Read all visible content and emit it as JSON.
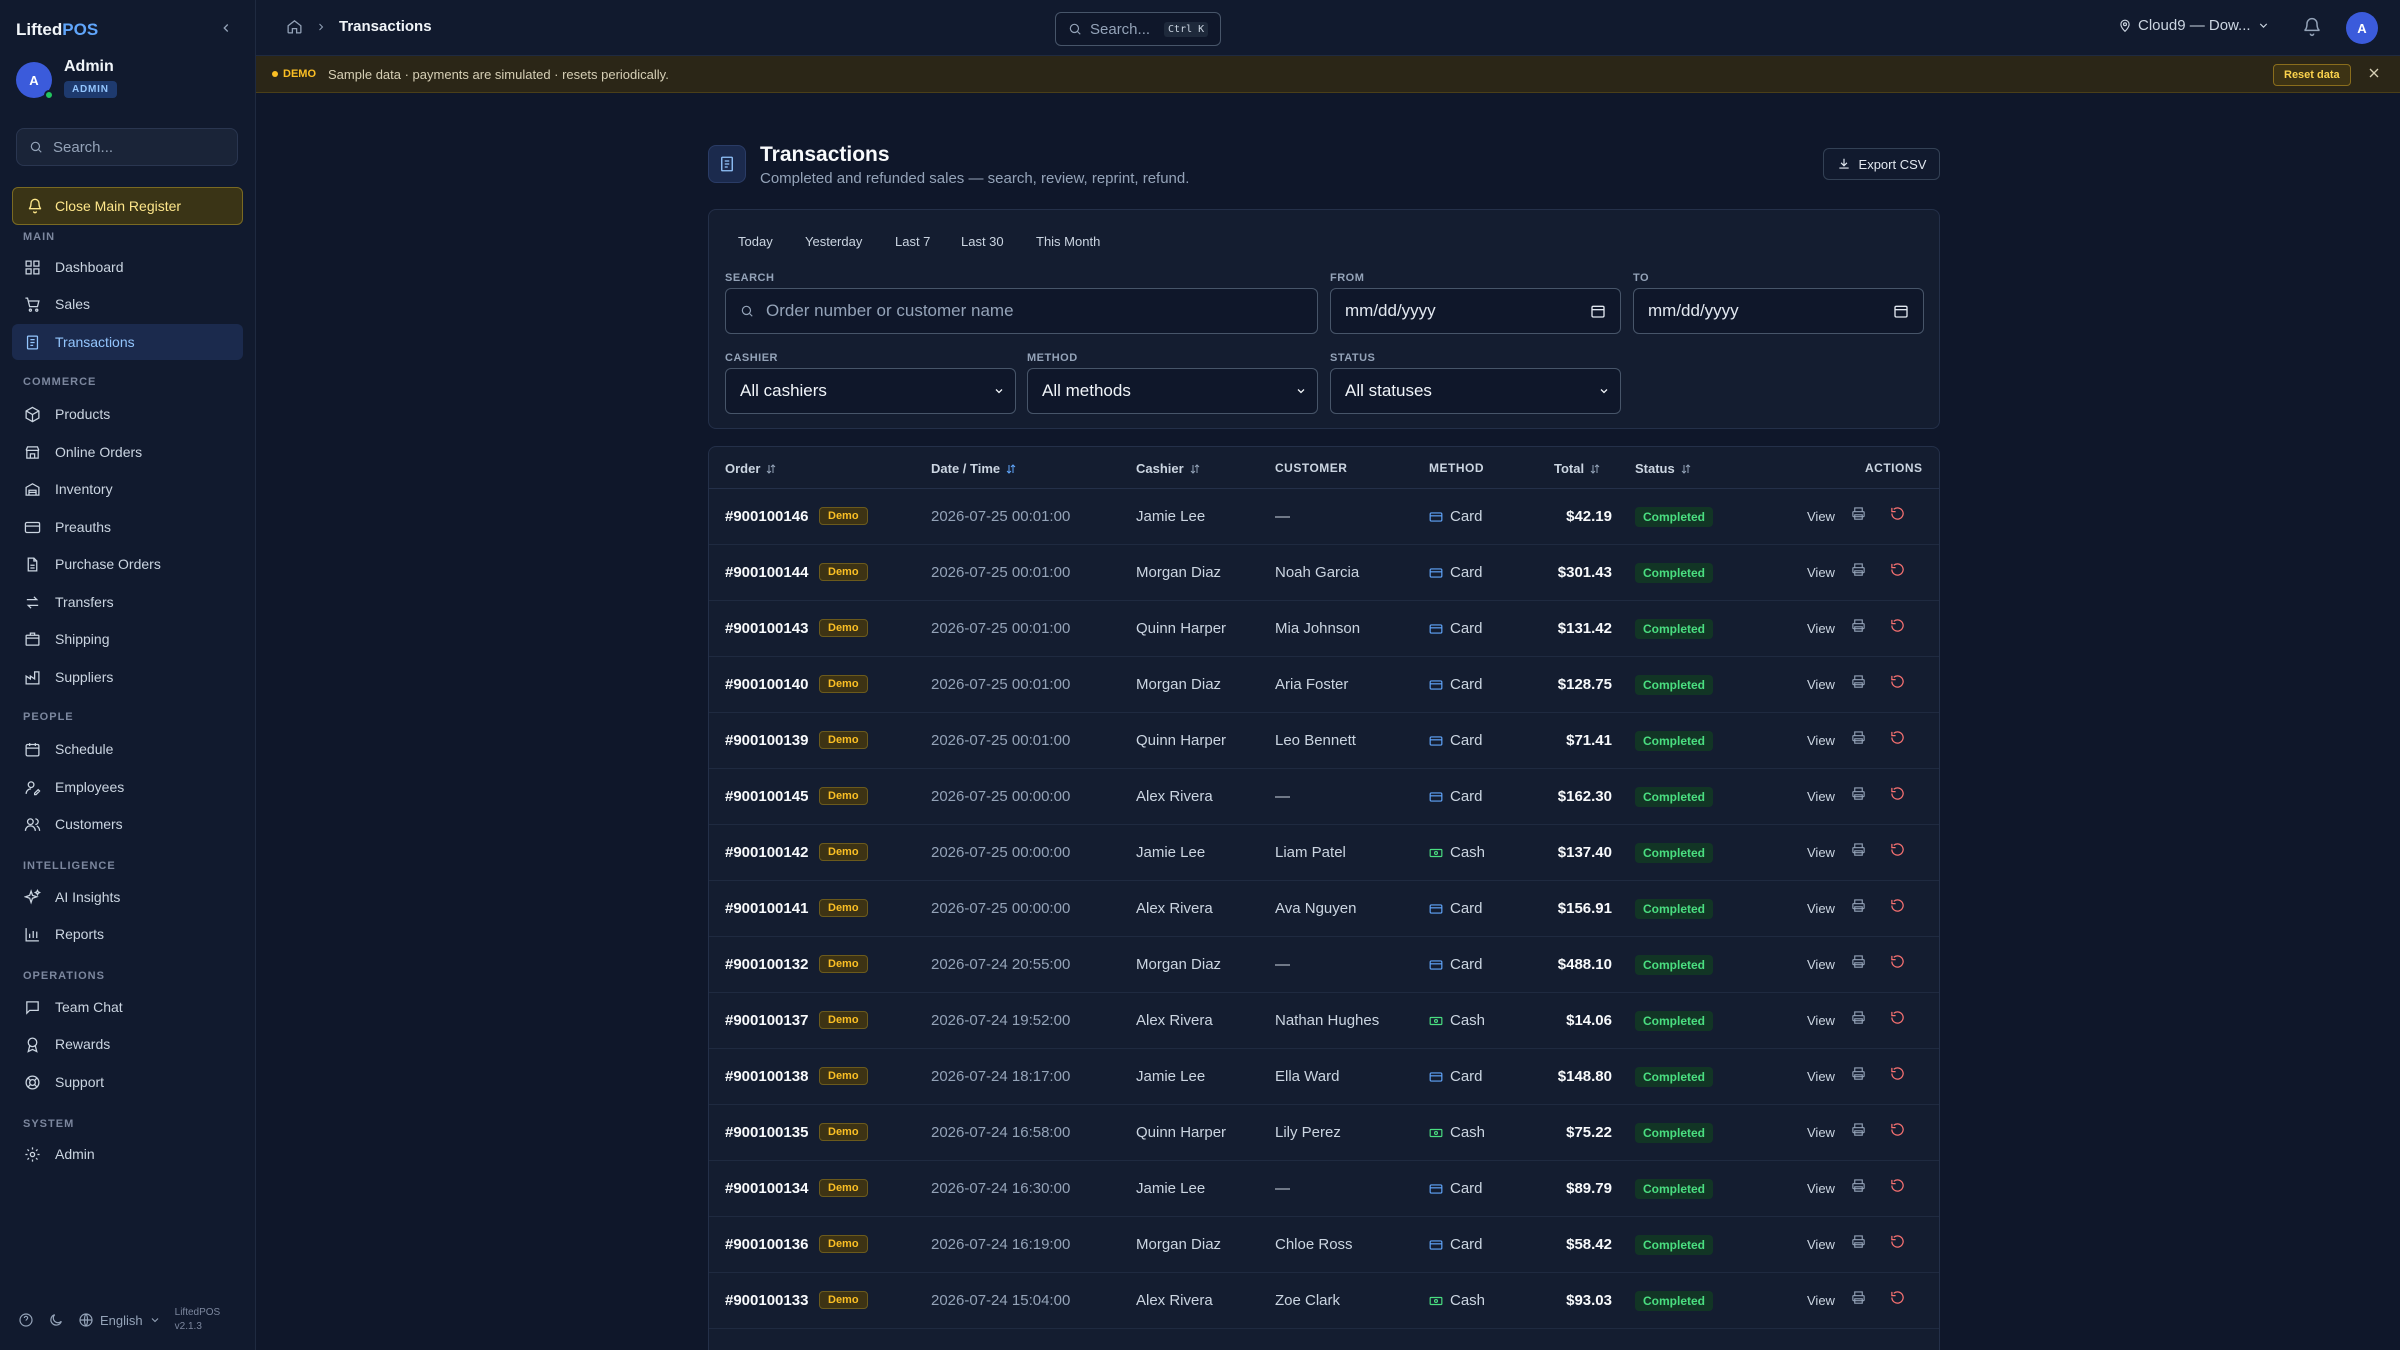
{
  "app": {
    "brand_part1": "Lifted",
    "brand_part2": "POS"
  },
  "user": {
    "initial": "A",
    "name": "Admin",
    "role": "ADMIN"
  },
  "sidebar": {
    "search_placeholder": "Search...",
    "close_register": "Close Main Register",
    "sections": {
      "main": "MAIN",
      "commerce": "COMMERCE",
      "people": "PEOPLE",
      "intelligence": "INTELLIGENCE",
      "operations": "OPERATIONS",
      "system": "SYSTEM"
    },
    "items": {
      "dashboard": "Dashboard",
      "sales": "Sales",
      "transactions": "Transactions",
      "products": "Products",
      "online_orders": "Online Orders",
      "inventory": "Inventory",
      "preauths": "Preauths",
      "purchase_orders": "Purchase Orders",
      "transfers": "Transfers",
      "shipping": "Shipping",
      "suppliers": "Suppliers",
      "schedule": "Schedule",
      "employees": "Employees",
      "customers": "Customers",
      "ai_insights": "AI Insights",
      "reports": "Reports",
      "team_chat": "Team Chat",
      "rewards": "Rewards",
      "support": "Support",
      "admin": "Admin"
    },
    "footer": {
      "language": "English",
      "app_name": "LiftedPOS",
      "version": "v2.1.3"
    }
  },
  "topbar": {
    "breadcrumb_current": "Transactions",
    "search_label": "Search...",
    "search_shortcut": "Ctrl K",
    "location": "Cloud9 — Dow...",
    "avatar_initial": "A"
  },
  "banner": {
    "tag": "DEMO",
    "message": "Sample data · payments are simulated · resets periodically.",
    "reset_label": "Reset data"
  },
  "page": {
    "title": "Transactions",
    "subtitle": "Completed and refunded sales — search, review, reprint, refund.",
    "export_label": "Export CSV"
  },
  "filters": {
    "quick_ranges": [
      "Today",
      "Yesterday",
      "Last 7",
      "Last 30",
      "This Month"
    ],
    "search_label": "SEARCH",
    "search_placeholder": "Order number or customer name",
    "from_label": "FROM",
    "from_value": "mm/dd/yyyy",
    "to_label": "TO",
    "to_value": "mm/dd/yyyy",
    "cashier_label": "CASHIER",
    "cashier_value": "All cashiers",
    "method_label": "METHOD",
    "method_value": "All methods",
    "status_label": "STATUS",
    "status_value": "All statuses"
  },
  "table": {
    "headers": {
      "order": "Order",
      "date": "Date / Time",
      "cashier": "Cashier",
      "customer": "CUSTOMER",
      "method": "METHOD",
      "total": "Total",
      "status": "Status",
      "actions": "ACTIONS"
    },
    "demo_badge": "Demo",
    "view_label": "View",
    "rows": [
      {
        "order": "#900100146",
        "date": "2026-07-25 00:01:00",
        "cashier": "Jamie Lee",
        "customer": "—",
        "method": "Card",
        "total": "$42.19",
        "status": "Completed"
      },
      {
        "order": "#900100144",
        "date": "2026-07-25 00:01:00",
        "cashier": "Morgan Diaz",
        "customer": "Noah Garcia",
        "method": "Card",
        "total": "$301.43",
        "status": "Completed"
      },
      {
        "order": "#900100143",
        "date": "2026-07-25 00:01:00",
        "cashier": "Quinn Harper",
        "customer": "Mia Johnson",
        "method": "Card",
        "total": "$131.42",
        "status": "Completed"
      },
      {
        "order": "#900100140",
        "date": "2026-07-25 00:01:00",
        "cashier": "Morgan Diaz",
        "customer": "Aria Foster",
        "method": "Card",
        "total": "$128.75",
        "status": "Completed"
      },
      {
        "order": "#900100139",
        "date": "2026-07-25 00:01:00",
        "cashier": "Quinn Harper",
        "customer": "Leo Bennett",
        "method": "Card",
        "total": "$71.41",
        "status": "Completed"
      },
      {
        "order": "#900100145",
        "date": "2026-07-25 00:00:00",
        "cashier": "Alex Rivera",
        "customer": "—",
        "method": "Card",
        "total": "$162.30",
        "status": "Completed"
      },
      {
        "order": "#900100142",
        "date": "2026-07-25 00:00:00",
        "cashier": "Jamie Lee",
        "customer": "Liam Patel",
        "method": "Cash",
        "total": "$137.40",
        "status": "Completed"
      },
      {
        "order": "#900100141",
        "date": "2026-07-25 00:00:00",
        "cashier": "Alex Rivera",
        "customer": "Ava Nguyen",
        "method": "Card",
        "total": "$156.91",
        "status": "Completed"
      },
      {
        "order": "#900100132",
        "date": "2026-07-24 20:55:00",
        "cashier": "Morgan Diaz",
        "customer": "—",
        "method": "Card",
        "total": "$488.10",
        "status": "Completed"
      },
      {
        "order": "#900100137",
        "date": "2026-07-24 19:52:00",
        "cashier": "Alex Rivera",
        "customer": "Nathan Hughes",
        "method": "Cash",
        "total": "$14.06",
        "status": "Completed"
      },
      {
        "order": "#900100138",
        "date": "2026-07-24 18:17:00",
        "cashier": "Jamie Lee",
        "customer": "Ella Ward",
        "method": "Card",
        "total": "$148.80",
        "status": "Completed"
      },
      {
        "order": "#900100135",
        "date": "2026-07-24 16:58:00",
        "cashier": "Quinn Harper",
        "customer": "Lily Perez",
        "method": "Cash",
        "total": "$75.22",
        "status": "Completed"
      },
      {
        "order": "#900100134",
        "date": "2026-07-24 16:30:00",
        "cashier": "Jamie Lee",
        "customer": "—",
        "method": "Card",
        "total": "$89.79",
        "status": "Completed"
      },
      {
        "order": "#900100136",
        "date": "2026-07-24 16:19:00",
        "cashier": "Morgan Diaz",
        "customer": "Chloe Ross",
        "method": "Card",
        "total": "$58.42",
        "status": "Completed"
      },
      {
        "order": "#900100133",
        "date": "2026-07-24 15:04:00",
        "cashier": "Alex Rivera",
        "customer": "Zoe Clark",
        "method": "Cash",
        "total": "$93.03",
        "status": "Completed"
      }
    ]
  },
  "colors": {
    "accent": "#60a5fa",
    "demo": "#fbbf24",
    "completed": "#4ade80",
    "refund_icon": "#f87171"
  }
}
